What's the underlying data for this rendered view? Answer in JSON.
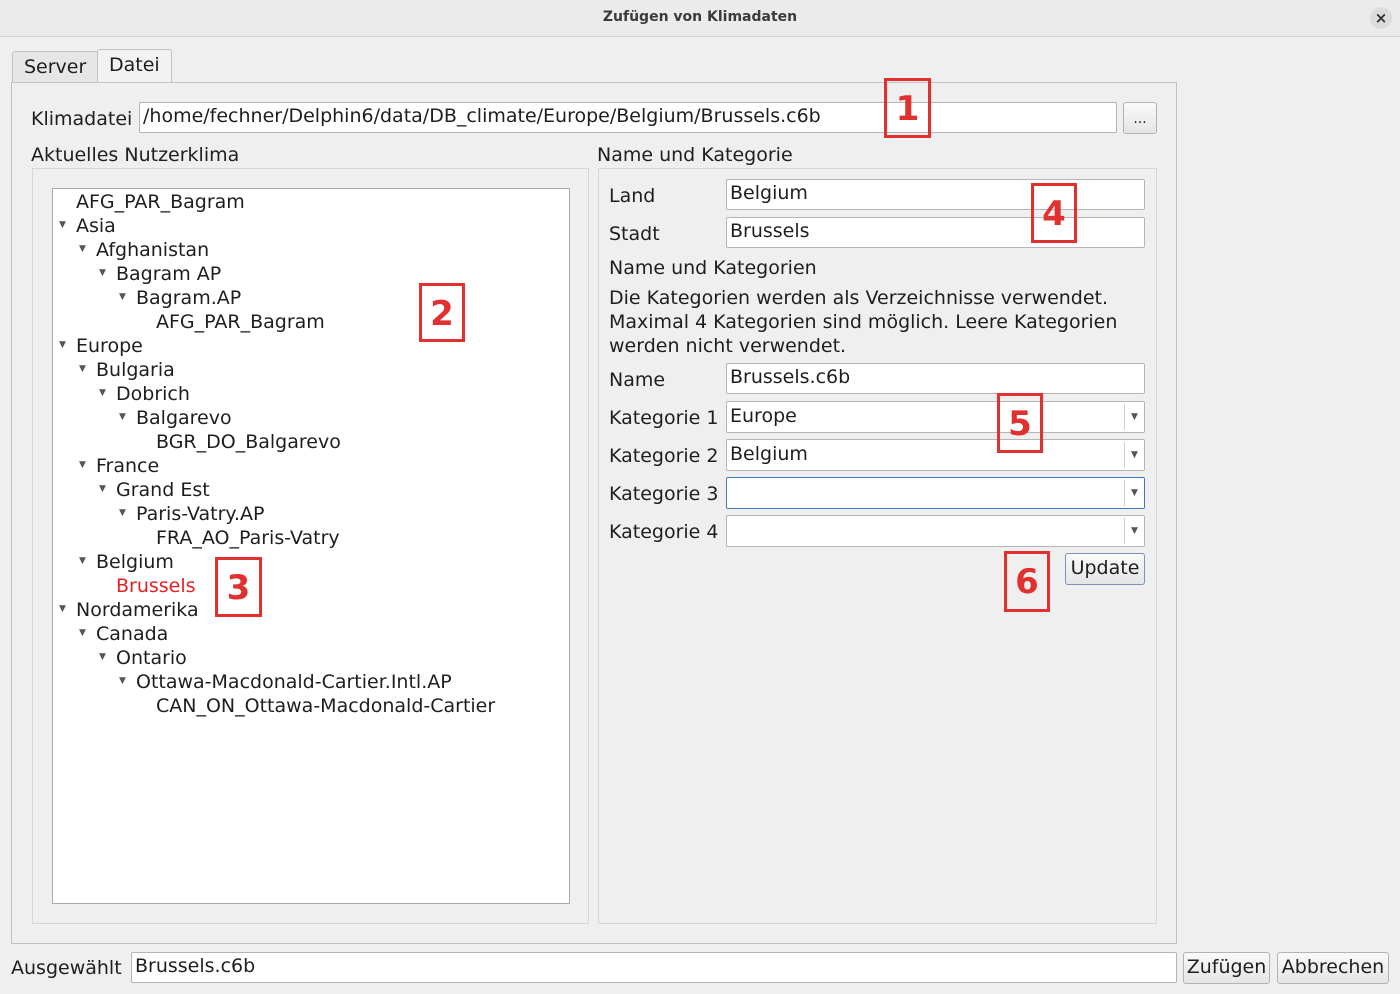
{
  "window": {
    "title": "Zufügen von Klimadaten",
    "close_glyph": "×"
  },
  "tabs": [
    {
      "label": "Server"
    },
    {
      "label": "Datei"
    }
  ],
  "file": {
    "label": "Klimadatei",
    "path": "/home/fechner/Delphin6/data/DB_climate/Europe/Belgium/Brussels.c6b",
    "browse_label": "..."
  },
  "tree_section": {
    "title": "Aktuelles Nutzerklima"
  },
  "tree": [
    {
      "label": "AFG_PAR_Bagram",
      "depth": 0,
      "expanded": false,
      "leaf": true
    },
    {
      "label": "Asia",
      "depth": 0,
      "expanded": true
    },
    {
      "label": "Afghanistan",
      "depth": 1,
      "expanded": true
    },
    {
      "label": "Bagram AP",
      "depth": 2,
      "expanded": true
    },
    {
      "label": "Bagram.AP",
      "depth": 3,
      "expanded": true
    },
    {
      "label": "AFG_PAR_Bagram",
      "depth": 4,
      "leaf": true
    },
    {
      "label": "Europe",
      "depth": 0,
      "expanded": true
    },
    {
      "label": "Bulgaria",
      "depth": 1,
      "expanded": true
    },
    {
      "label": "Dobrich",
      "depth": 2,
      "expanded": true
    },
    {
      "label": "Balgarevo",
      "depth": 3,
      "expanded": true
    },
    {
      "label": "BGR_DO_Balgarevo",
      "depth": 4,
      "leaf": true
    },
    {
      "label": "France",
      "depth": 1,
      "expanded": true
    },
    {
      "label": "Grand Est",
      "depth": 2,
      "expanded": true
    },
    {
      "label": "Paris-Vatry.AP",
      "depth": 3,
      "expanded": true
    },
    {
      "label": "FRA_AO_Paris-Vatry",
      "depth": 4,
      "leaf": true
    },
    {
      "label": "Belgium",
      "depth": 1,
      "expanded": true
    },
    {
      "label": "Brussels",
      "depth": 2,
      "leaf": true,
      "selected": true
    },
    {
      "label": "Nordamerika",
      "depth": 0,
      "expanded": true
    },
    {
      "label": "Canada",
      "depth": 1,
      "expanded": true
    },
    {
      "label": "Ontario",
      "depth": 2,
      "expanded": true
    },
    {
      "label": "Ottawa-Macdonald-Cartier.Intl.AP",
      "depth": 3,
      "expanded": true
    },
    {
      "label": "CAN_ON_Ottawa-Macdonald-Cartier",
      "depth": 4,
      "leaf": true
    }
  ],
  "name_section": {
    "title": "Name und Kategorie",
    "land_label": "Land",
    "land_value": "Belgium",
    "stadt_label": "Stadt",
    "stadt_value": "Brussels",
    "subtitle": "Name und Kategorien",
    "desc_line1": "Die Kategorien werden als Verzeichnisse verwendet.",
    "desc_line2": "Maximal 4 Kategorien sind möglich. Leere Kategorien",
    "desc_line3": "werden nicht verwendet.",
    "name_label": "Name",
    "name_value": "Brussels.c6b",
    "categories": [
      {
        "label": "Kategorie 1",
        "value": "Europe"
      },
      {
        "label": "Kategorie 2",
        "value": "Belgium"
      },
      {
        "label": "Kategorie 3",
        "value": ""
      },
      {
        "label": "Kategorie 4",
        "value": ""
      }
    ],
    "update_label": "Update"
  },
  "footer": {
    "label": "Ausgewählt",
    "value": "Brussels.c6b",
    "add_label": "Zufügen",
    "cancel_label": "Abbrechen"
  },
  "markers": [
    "1",
    "2",
    "3",
    "4",
    "5",
    "6"
  ],
  "colors": {
    "marker": "#e0302f",
    "selected_item": "#e82020"
  }
}
